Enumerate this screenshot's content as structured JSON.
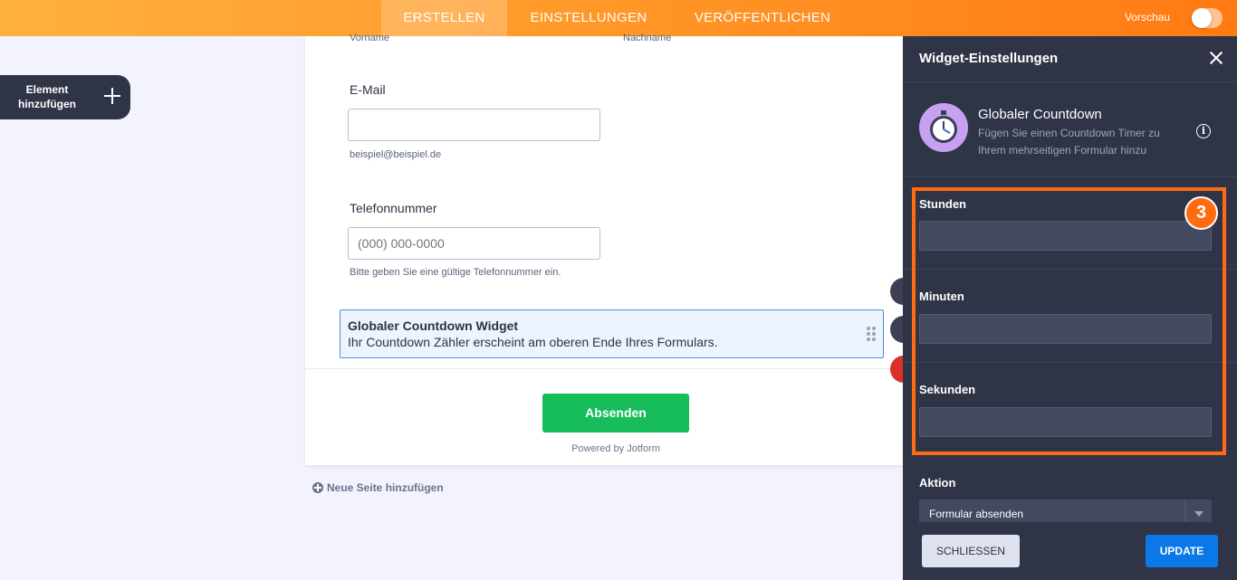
{
  "topbar": {
    "tabs": [
      {
        "label": "ERSTELLEN",
        "active": true
      },
      {
        "label": "EINSTELLUNGEN",
        "active": false
      },
      {
        "label": "VERÖFFENTLICHEN",
        "active": false
      }
    ],
    "preview_label": "Vorschau",
    "preview_on": false
  },
  "sidebar": {
    "add_element_label": "Element hinzufügen"
  },
  "form": {
    "sublabel_first": "Vorname",
    "sublabel_last": "Nachname",
    "email": {
      "label": "E-Mail",
      "value": "",
      "hint": "beispiel@beispiel.de"
    },
    "phone": {
      "label": "Telefonnummer",
      "placeholder": "(000) 000-0000",
      "hint": "Bitte geben Sie eine gültige Telefonnummer ein."
    },
    "widget": {
      "title": "Globaler Countdown Widget",
      "description": "Ihr Countdown Zähler erscheint am oberen Ende Ihres Formulars."
    },
    "submit_label": "Absenden",
    "powered_by": "Powered by Jotform"
  },
  "new_page_label": "Neue Seite hinzufügen",
  "panel": {
    "title": "Widget-Einstellungen",
    "widget_name": "Globaler Countdown",
    "widget_description": "Fügen Sie einen Countdown Timer zu Ihrem mehrseitigen Formular hinzu",
    "fields": [
      {
        "label": "Stunden",
        "value": ""
      },
      {
        "label": "Minuten",
        "value": ""
      },
      {
        "label": "Sekunden",
        "value": ""
      }
    ],
    "step_badge": "3",
    "action": {
      "label": "Aktion",
      "selected": "Formular absenden"
    },
    "close_label": "SCHLIESSEN",
    "update_label": "UPDATE"
  },
  "colors": {
    "highlight": "#ff6b10",
    "accent_green": "#18bd5b",
    "accent_blue": "#0a78e8"
  }
}
